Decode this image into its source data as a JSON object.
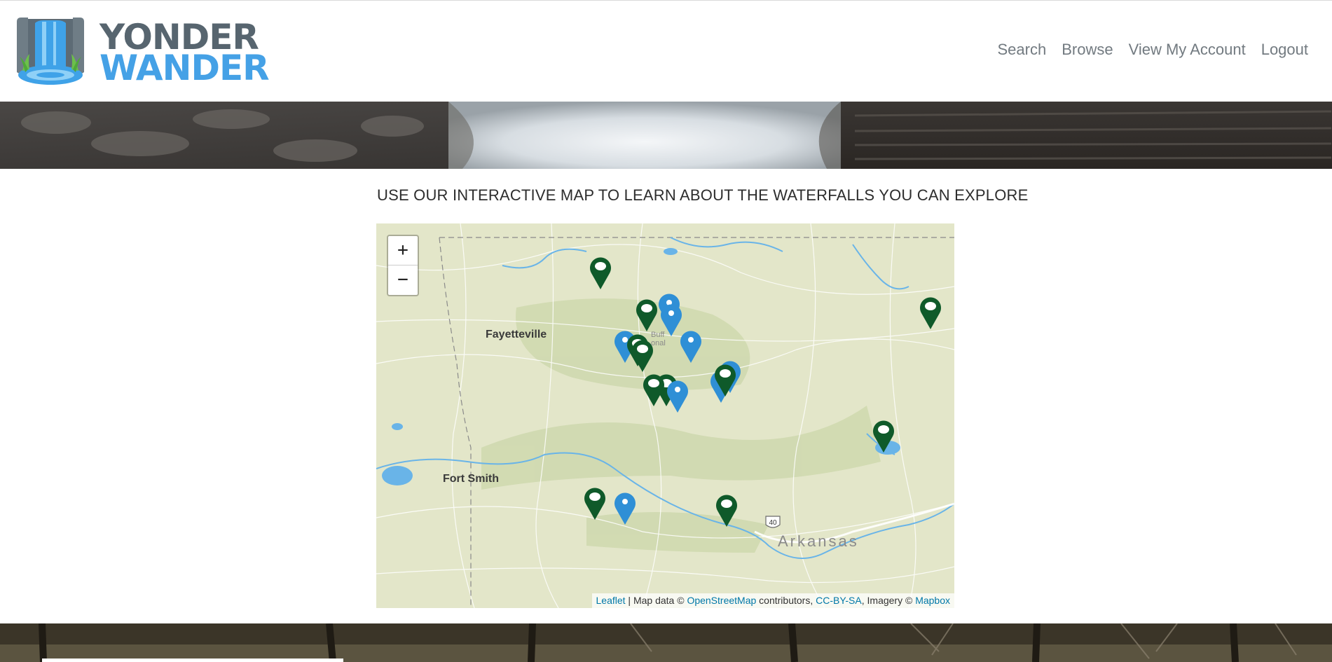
{
  "brand": {
    "line1": "YONDER",
    "line2": "WANDER"
  },
  "nav": {
    "search": "Search",
    "browse": "Browse",
    "account": "View My Account",
    "logout": "Logout"
  },
  "main": {
    "heading": "USE OUR INTERACTIVE MAP TO LEARN ABOUT THE WATERFALLS YOU CAN EXPLORE"
  },
  "map": {
    "zoom_in": "+",
    "zoom_out": "−",
    "labels": {
      "fayetteville": "Fayetteville",
      "fort_smith": "Fort Smith",
      "arkansas": "Arkansas",
      "highway": "40",
      "buffalo": "Buff",
      "national": "onal"
    },
    "attribution": {
      "leaflet": "Leaflet",
      "sep": " | Map data © ",
      "osm": "OpenStreetMap",
      "contrib": " contributors, ",
      "license": "CC-BY-SA",
      "imagery": ", Imagery © ",
      "mapbox": "Mapbox"
    },
    "marker_colors": {
      "green": "#0f5a2a",
      "blue": "#2f8fd6"
    }
  }
}
